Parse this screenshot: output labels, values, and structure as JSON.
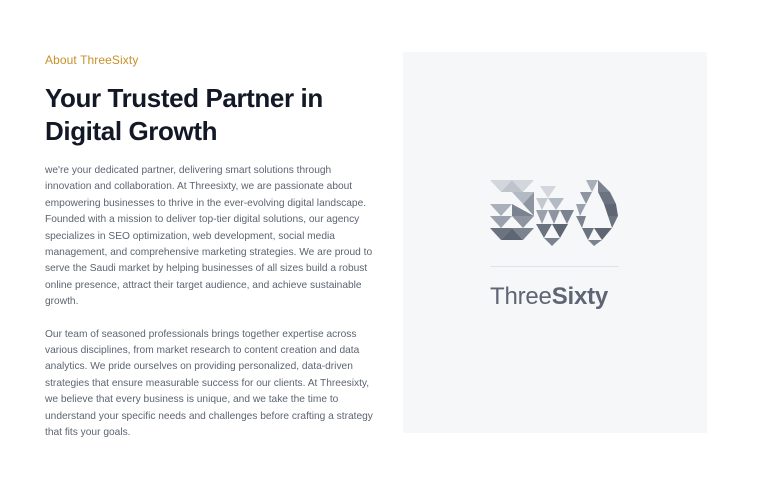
{
  "about": {
    "eyebrow": "About ThreeSixty",
    "title": "Your Trusted Partner in Digital Growth",
    "paragraphs": [
      "we're your dedicated partner, delivering smart solutions through innovation and collaboration. At Threesixty, we are passionate about empowering businesses to thrive in the ever-evolving digital landscape. Founded with a mission to deliver top-tier digital solutions, our agency specializes in SEO optimization, web development, social media management, and comprehensive marketing strategies. We are proud to serve the Saudi market by helping businesses of all sizes build a robust online presence, attract their target audience, and achieve sustainable growth.",
      "Our team of seasoned professionals brings together expertise across various disciplines, from market research to content creation and data analytics. We pride ourselves on providing personalized, data-driven strategies that ensure measurable success for our clients. At Threesixty, we believe that every business is unique, and we take the time to understand your specific needs and challenges before crafting a strategy that fits your goals."
    ]
  },
  "brand": {
    "logo_icon": "threesixty-360-logo-icon",
    "wordmark_light": "Three",
    "wordmark_bold": "Sixty",
    "colors": {
      "eyebrow": "#c8902a",
      "panel_bg": "#f6f7f9",
      "logo_light": "#d3d7dd",
      "logo_mid": "#a9afb9",
      "logo_dark": "#5f6673"
    }
  }
}
